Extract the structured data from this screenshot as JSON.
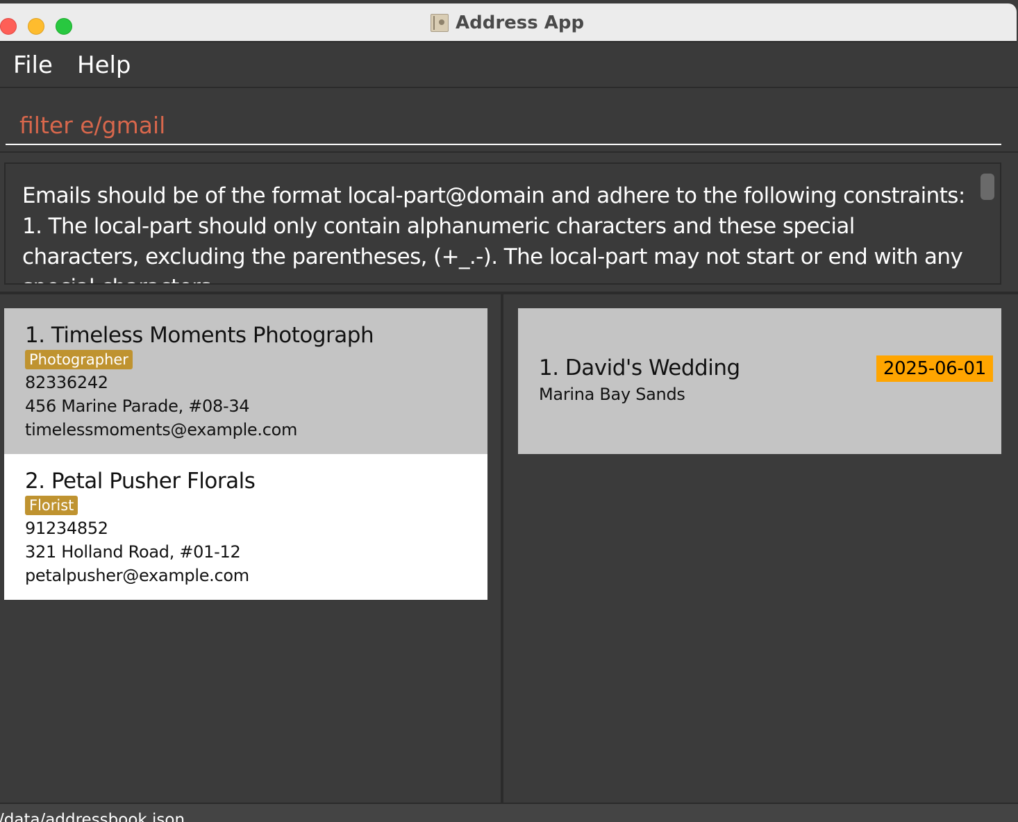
{
  "window": {
    "title": "Address App"
  },
  "menu": {
    "file": "File",
    "help": "Help"
  },
  "command": {
    "value": "filter e/gmail"
  },
  "result": {
    "text": "Emails should be of the format local-part@domain and adhere to the following constraints:\n1. The local-part should only contain alphanumeric characters and these special characters, excluding the parentheses, (+_.-). The local-part may not start or end with any special characters."
  },
  "persons": [
    {
      "name": "1. Timeless Moments Photograph",
      "tag": "Photographer",
      "phone": "82336242",
      "address": "456 Marine Parade, #08-34",
      "email": "timelessmoments@example.com"
    },
    {
      "name": "2. Petal Pusher Florals",
      "tag": "Florist",
      "phone": "91234852",
      "address": "321 Holland Road, #01-12",
      "email": "petalpusher@example.com"
    }
  ],
  "events": [
    {
      "name": "1. David's Wedding",
      "location": "Marina Bay Sands",
      "date": "2025-06-01"
    }
  ],
  "status": {
    "path": "/data/addressbook.json"
  },
  "colors": {
    "accent_command": "#d8674c",
    "tag": "#bf9330",
    "date": "#ffa500"
  },
  "icons": {
    "app": "address-book-icon"
  }
}
